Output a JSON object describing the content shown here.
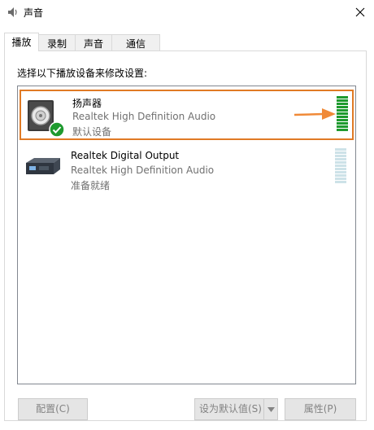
{
  "window": {
    "title": "声音",
    "icon": "speaker-icon"
  },
  "tabs": [
    {
      "label": "播放",
      "active": true
    },
    {
      "label": "录制",
      "active": false
    },
    {
      "label": "声音",
      "active": false
    },
    {
      "label": "通信",
      "active": false
    }
  ],
  "instruction": "选择以下播放设备来修改设置:",
  "devices": [
    {
      "name": "扬声器",
      "driver": "Realtek High Definition Audio",
      "status": "默认设备",
      "icon": "speaker-device-icon",
      "default_badge": "check-icon",
      "selected": true,
      "level": 1.0
    },
    {
      "name": "Realtek Digital Output",
      "driver": "Realtek High Definition Audio",
      "status": "准备就绪",
      "icon": "digital-output-device-icon",
      "selected": false,
      "level": 0.0
    }
  ],
  "buttons": {
    "configure": "配置(C)",
    "set_default": "设为默认值(S)",
    "properties": "属性(P)"
  },
  "colors": {
    "selection_border": "#e07a25",
    "arrow": "#f08a38",
    "meter_active": "#1f9a2f",
    "meter_inactive": "#cde2e8"
  }
}
